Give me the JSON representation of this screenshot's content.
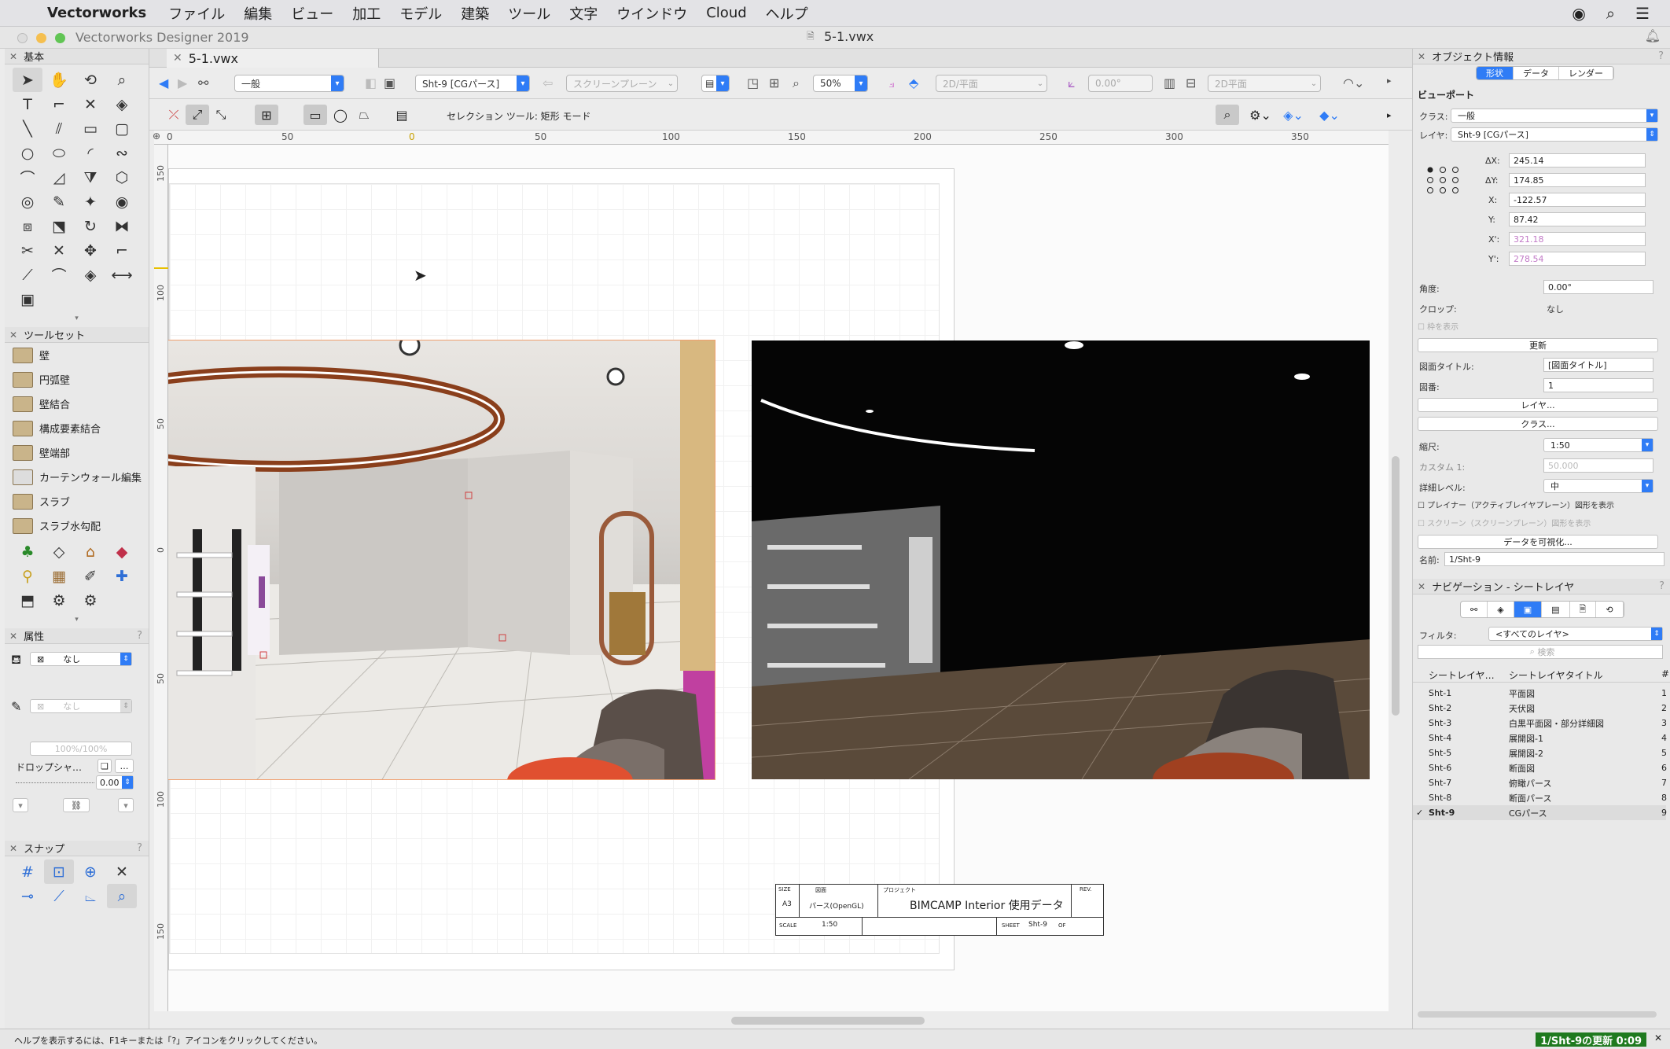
{
  "menubar": {
    "app": "Vectorworks",
    "items": [
      "ファイル",
      "編集",
      "ビュー",
      "加工",
      "モデル",
      "建築",
      "ツール",
      "文字",
      "ウインドウ",
      "Cloud",
      "ヘルプ"
    ]
  },
  "window": {
    "app_title": "Vectorworks Designer 2019",
    "file_title": "5-1.vwx",
    "doc_tab": "5-1.vwx"
  },
  "palettes": {
    "basic_title": "基本",
    "toolset_title": "ツールセット",
    "toolset_items": [
      "壁",
      "円弧壁",
      "壁結合",
      "構成要素結合",
      "壁端部",
      "カーテンウォール編集",
      "スラブ",
      "スラブ水勾配"
    ],
    "attributes_title": "属性",
    "fill_value": "なし",
    "pen_value": "なし",
    "opacity": "100%/100%",
    "drop_shadow_label": "ドロップシャ…",
    "line_weight": "0.00",
    "snap_title": "スナップ"
  },
  "viewbar": {
    "class_combo": "一般",
    "layer_combo": "Sht-9 [CGパース]",
    "plane_combo": "スクリーンプレーン",
    "zoom_combo": "50%",
    "view_combo": "2D/平面",
    "angle_value": "0.00°",
    "render_combo": "2D平面"
  },
  "modebar": {
    "mode_text": "セレクション ツール: 矩形 モード"
  },
  "rulers": {
    "h_ticks": [
      "0",
      "50",
      "0",
      "50",
      "100",
      "150",
      "200",
      "250",
      "300",
      "350"
    ],
    "v_ticks": [
      "150",
      "100",
      "50",
      "0",
      "50",
      "100",
      "150"
    ]
  },
  "title_block": {
    "size_label": "SIZE",
    "size_value": "A3",
    "drawing_label": "図面",
    "drawing_value": "パース(OpenGL)",
    "project_label": "プロジェクト",
    "project_value": "BIMCAMP Interior 使用データ",
    "rev_label": "REV.",
    "scale_label": "SCALE",
    "scale_value": "1:50",
    "sheet_label": "SHEET",
    "sheet_value": "Sht-9",
    "of_label": "OF"
  },
  "obj_info": {
    "title": "オブジェクト情報",
    "tabs": [
      "形状",
      "データ",
      "レンダー"
    ],
    "active_tab": 0,
    "section": "ビューポート",
    "class_label": "クラス:",
    "class_value": "一般",
    "layer_label": "レイヤ:",
    "layer_value": "Sht-9 [CGパース]",
    "dx_label": "ΔX:",
    "dx": "245.14",
    "dy_label": "ΔY:",
    "dy": "174.85",
    "x_label": "X:",
    "x": "-122.57",
    "y_label": "Y:",
    "y": "87.42",
    "x2_label": "X':",
    "x2": "321.18",
    "y2_label": "Y':",
    "y2": "278.54",
    "angle_label": "角度:",
    "angle": "0.00°",
    "crop_label": "クロップ:",
    "crop": "なし",
    "show_frame": "枠を表示",
    "update_button": "更新",
    "drawing_title_label": "図面タイトル:",
    "drawing_title": "[図面タイトル]",
    "drawing_no_label": "図番:",
    "drawing_no": "1",
    "layer_button": "レイヤ...",
    "class_button": "クラス...",
    "scale_label": "縮尺:",
    "scale": "1:50",
    "custom_label": "カスタム 1:",
    "custom": "50.000",
    "detail_label": "詳細レベル:",
    "detail": "中",
    "check_planar": "プレイナー（アクティブレイヤプレーン）図形を表示",
    "check_screen": "スクリーン（スクリーンプレーン）図形を表示",
    "visualize_button": "データを可視化...",
    "name_label": "名前:",
    "name": "1/Sht-9"
  },
  "navigation": {
    "title": "ナビゲーション - シートレイヤ",
    "filter_label": "フィルタ:",
    "filter_value": "<すべてのレイヤ>",
    "search_placeholder": "検索",
    "col1": "シートレイヤ…",
    "col2": "シートレイヤタイトル",
    "col3": "#",
    "rows": [
      {
        "id": "Sht-1",
        "title": "平面図",
        "num": "1"
      },
      {
        "id": "Sht-2",
        "title": "天伏図",
        "num": "2"
      },
      {
        "id": "Sht-3",
        "title": "白黒平面図・部分詳細図",
        "num": "3"
      },
      {
        "id": "Sht-4",
        "title": "展開図-1",
        "num": "4"
      },
      {
        "id": "Sht-5",
        "title": "展開図-2",
        "num": "5"
      },
      {
        "id": "Sht-6",
        "title": "断面図",
        "num": "6"
      },
      {
        "id": "Sht-7",
        "title": "俯瞰パース",
        "num": "7"
      },
      {
        "id": "Sht-8",
        "title": "断面パース",
        "num": "8"
      },
      {
        "id": "Sht-9",
        "title": "CGパース",
        "num": "9",
        "active": true
      }
    ]
  },
  "status": {
    "help": "ヘルプを表示するには、F1キーまたは「?」アイコンをクリックしてください。",
    "update": "1/Sht-9の更新 0:09"
  },
  "colors": {
    "accent": "#2f7cf6",
    "status_green": "#1f7a1f"
  }
}
